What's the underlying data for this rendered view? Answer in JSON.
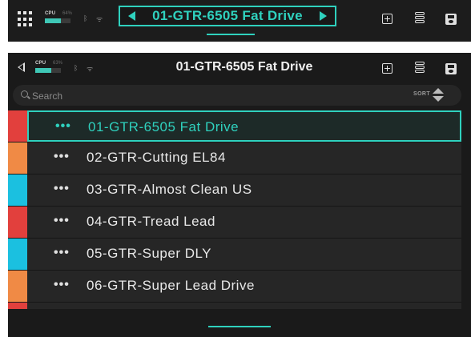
{
  "topbar": {
    "cpu_label": "CPU",
    "cpu_percent": "64%",
    "cpu_level": 0.64,
    "preset_name": "01-GTR-6505 Fat Drive",
    "icons": [
      "grid-icon",
      "bluetooth-icon",
      "wifi-icon",
      "prev-arrow-icon",
      "next-arrow-icon",
      "add-preset-icon",
      "stack-icon",
      "save-icon"
    ]
  },
  "header": {
    "cpu_label": "CPU",
    "cpu_percent": "63%",
    "cpu_level": 0.63,
    "title": "01-GTR-6505 Fat Drive"
  },
  "search": {
    "placeholder": "Search",
    "value": "",
    "sort_label": "SORT"
  },
  "presets": [
    {
      "name": "01-GTR-6505 Fat Drive",
      "color": "#e2403d",
      "selected": true
    },
    {
      "name": "02-GTR-Cutting EL84",
      "color": "#f08a45",
      "selected": false
    },
    {
      "name": "03-GTR-Almost Clean US",
      "color": "#1bc0e0",
      "selected": false
    },
    {
      "name": "04-GTR-Tread Lead",
      "color": "#e2403d",
      "selected": false
    },
    {
      "name": "05-GTR-Super DLY",
      "color": "#1bc0e0",
      "selected": false
    },
    {
      "name": "06-GTR-Super Lead Drive",
      "color": "#f08a45",
      "selected": false
    },
    {
      "name": "",
      "color": "#e2403d",
      "selected": false
    }
  ],
  "colors": {
    "accent": "#2fd1be",
    "background": "#1a1a1a",
    "row": "#262626"
  }
}
